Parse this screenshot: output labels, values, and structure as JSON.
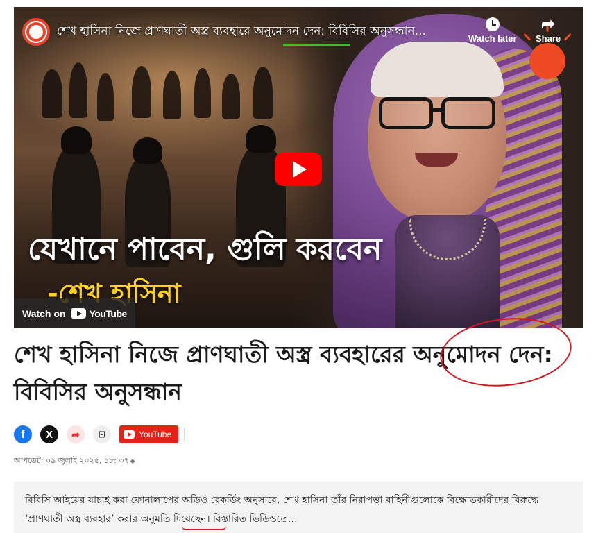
{
  "video": {
    "title": "শেখ হাসিনা নিজে প্রাণঘাতী অস্ত্র ব্যবহারে অনুমোদন দেন: বিবিসির অনুসন্ধান...",
    "watch_later_label": "Watch later",
    "share_label": "Share",
    "overlay_line1": "যেখানে পাবেন, গুলি করবেন",
    "overlay_line2": "-শেখ হাসিনা",
    "watch_on_label": "Watch on",
    "youtube_word": "YouTube",
    "accent_color": "#ff0000",
    "underline_color": "#34c224"
  },
  "article": {
    "headline": "শেখ হাসিনা নিজে প্রাণঘাতী অস্ত্র ব্যবহারের অনুমোদন দেন: বিবিসির অনুসন্ধান",
    "share_buttons": {
      "facebook": "f",
      "x": "X",
      "share": "➦",
      "bookmark": "⊡",
      "youtube_label": "YouTube"
    },
    "updated": "আপডেট: ০৯ জুলাই ২০২৫, ১৮: ৩৭",
    "summary": "বিবিসি আইয়ের যাচাই করা ফোনালাপের অডিও রেকর্ডিং অনুসারে, শেখ হাসিনা তাঁর নিরাপত্তা বাহিনীগুলোকে বিক্ষোভকারীদের বিরুদ্ধে ‘প্রাণঘাতী অস্ত্র ব্যবহার’ করার অনুমতি দিয়েছেন। বিস্তারিত ভিডিওতে…",
    "annotation_color": "#d8141c"
  }
}
